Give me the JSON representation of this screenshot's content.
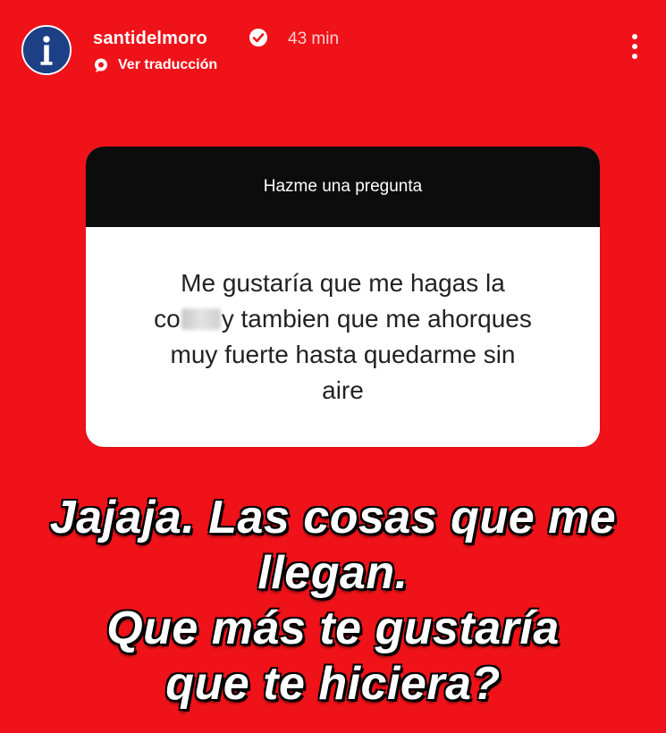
{
  "header": {
    "username": "santidelmoro",
    "time": "43 min",
    "translate_label": "Ver traducción"
  },
  "question_card": {
    "title": "Hazme una pregunta",
    "lines": [
      "Me gustaría que me hagas la",
      "co",
      "y tambien que me ahorques",
      "muy fuerte hasta quedarme sin",
      "aire"
    ]
  },
  "caption": {
    "lines": [
      "Jajaja. Las cosas que me",
      "llegan.",
      "Que más te gustaría",
      "que te hiciera?"
    ]
  },
  "colors": {
    "background": "#f01219",
    "card_header": "#0c0c0c",
    "avatar": "#1d3f86"
  },
  "icons": {
    "avatar": "avatar-logo-icon",
    "verified": "verified-badge-icon",
    "translate": "translate-bubble-icon",
    "more": "more-vertical-icon"
  }
}
